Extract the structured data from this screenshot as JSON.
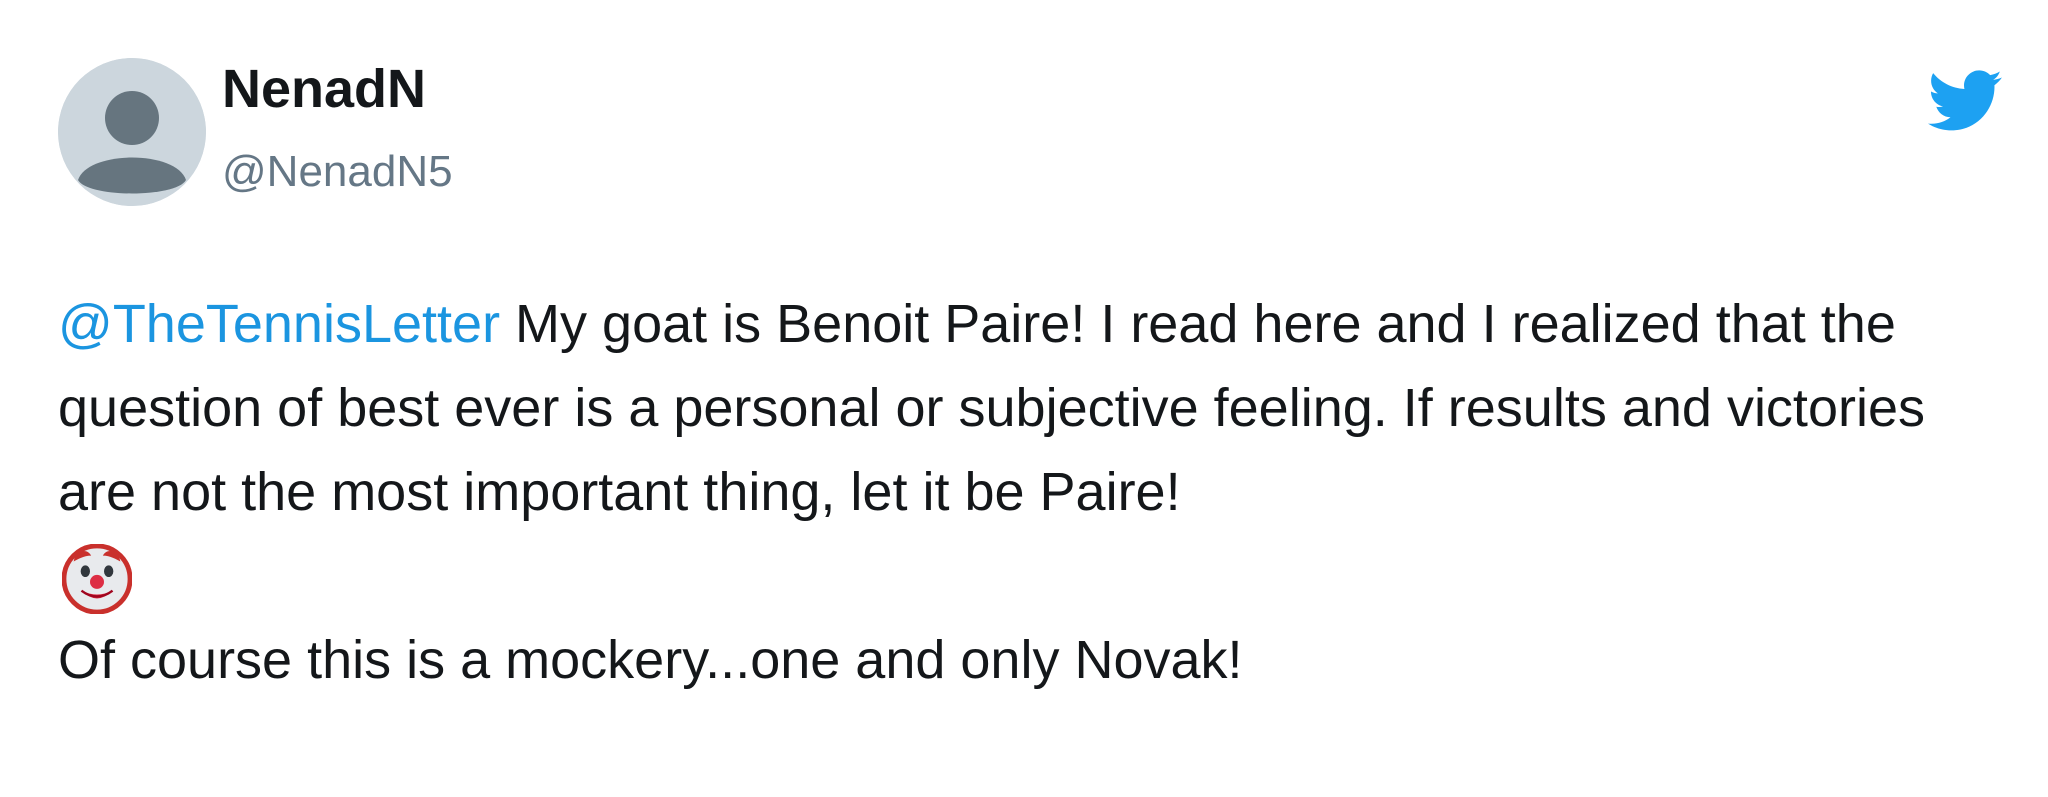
{
  "user": {
    "display_name": "NenadN",
    "handle": "@NenadN5",
    "avatar_icon": "default-profile-avatar-icon"
  },
  "brand": {
    "logo_icon": "twitter-bird-icon",
    "accent_color": "#1da1f2",
    "mention_color": "#1b95e0"
  },
  "tweet": {
    "mention": "@TheTennisLetter",
    "text_part1": " My goat is Benoit Paire! I read here and I realized that the question of best ever is a personal or subjective feeling. If results and victories are not the most important thing, let it be Paire!",
    "emoji_icon": "clown-face-emoji-icon",
    "text_part2": "Of course this is a mockery...one and only Novak!"
  }
}
